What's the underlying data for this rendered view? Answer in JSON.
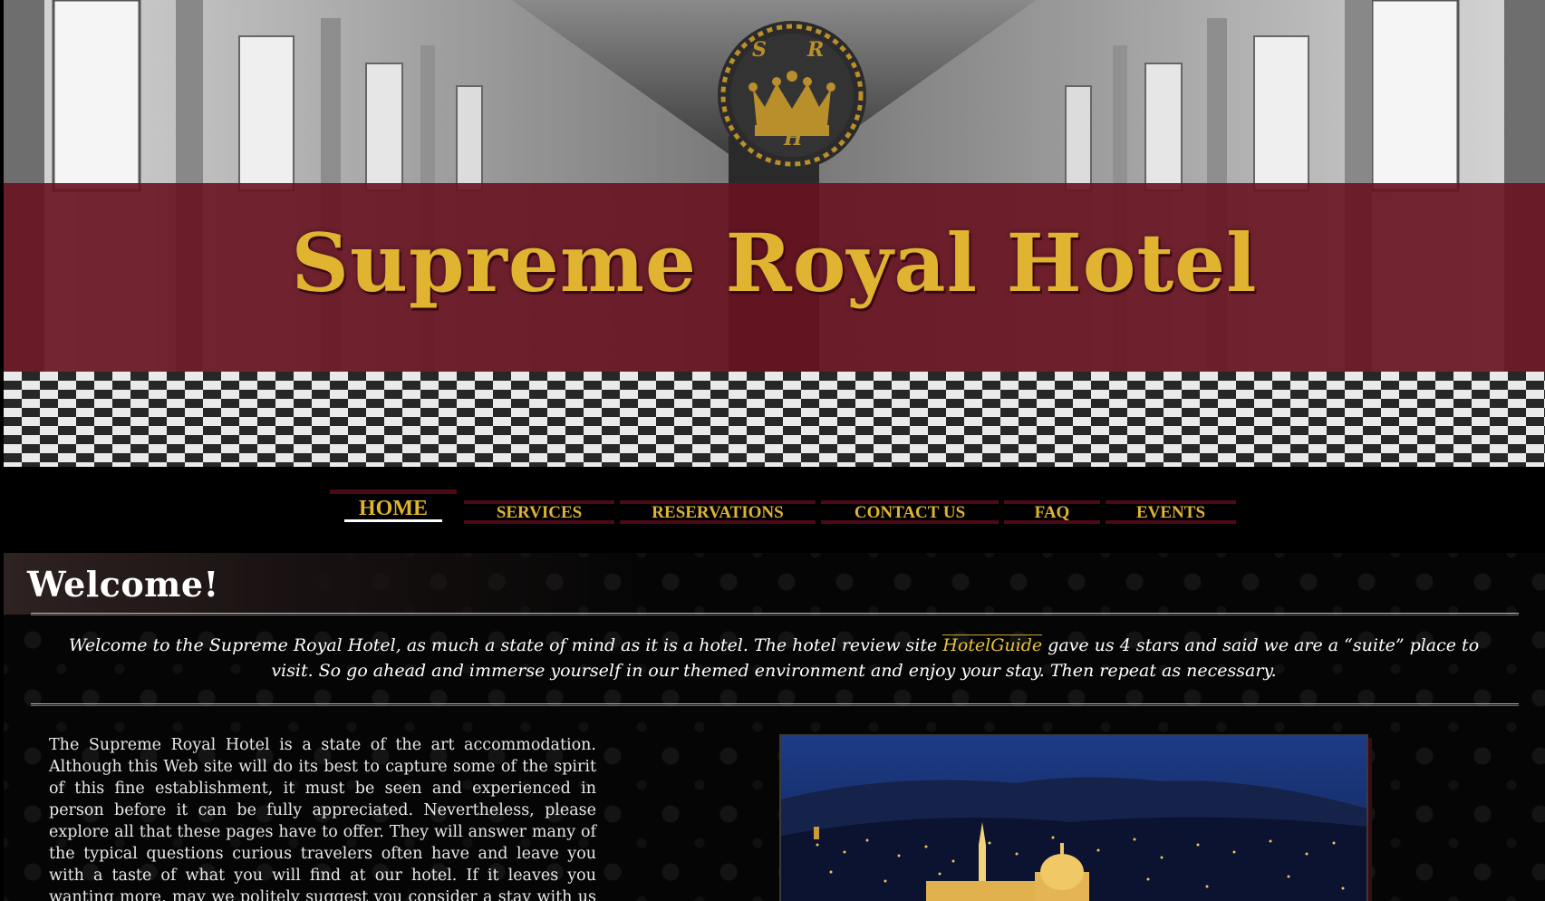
{
  "header": {
    "site_title": "Supreme Royal Hotel",
    "crest_letters": [
      "S",
      "R",
      "H"
    ]
  },
  "nav": {
    "items": [
      {
        "label": "HOME",
        "active": true
      },
      {
        "label": "SERVICES",
        "active": false
      },
      {
        "label": "RESERVATIONS",
        "active": false
      },
      {
        "label": "CONTACT US",
        "active": false
      },
      {
        "label": "FAQ",
        "active": false
      },
      {
        "label": "EVENTS",
        "active": false
      }
    ]
  },
  "welcome": {
    "heading": "Welcome!",
    "intro_before": "Welcome to the Supreme Royal Hotel, as much a state of mind as it is a hotel. The hotel review site ",
    "intro_link": "HotelGuide",
    "intro_after": " gave us 4 stars and said we are a “suite” place to visit. So go ahead and immerse yourself in our themed environment and enjoy your stay. Then repeat as necessary."
  },
  "body": {
    "paragraph": "The Supreme Royal Hotel is a state of the art accommodation. Although this Web site will do its best to capture some of the spirit of this fine establishment, it must be seen and experienced in person before it can be fully appreciated. Nevertheless, please explore all that these pages have to offer. They will answer many of the typical questions curious travelers often have and leave you with a taste of what you will find at our hotel. If it leaves you wanting more, may we politely suggest you consider a stay with us the next time you travel."
  },
  "colors": {
    "gold": "#e0b330",
    "maroon_band": "#681220",
    "nav_border": "#4b0a14",
    "link": "#e8c43a",
    "background": "#000000"
  },
  "icons": {
    "crest": "crown-crest-logo"
  }
}
